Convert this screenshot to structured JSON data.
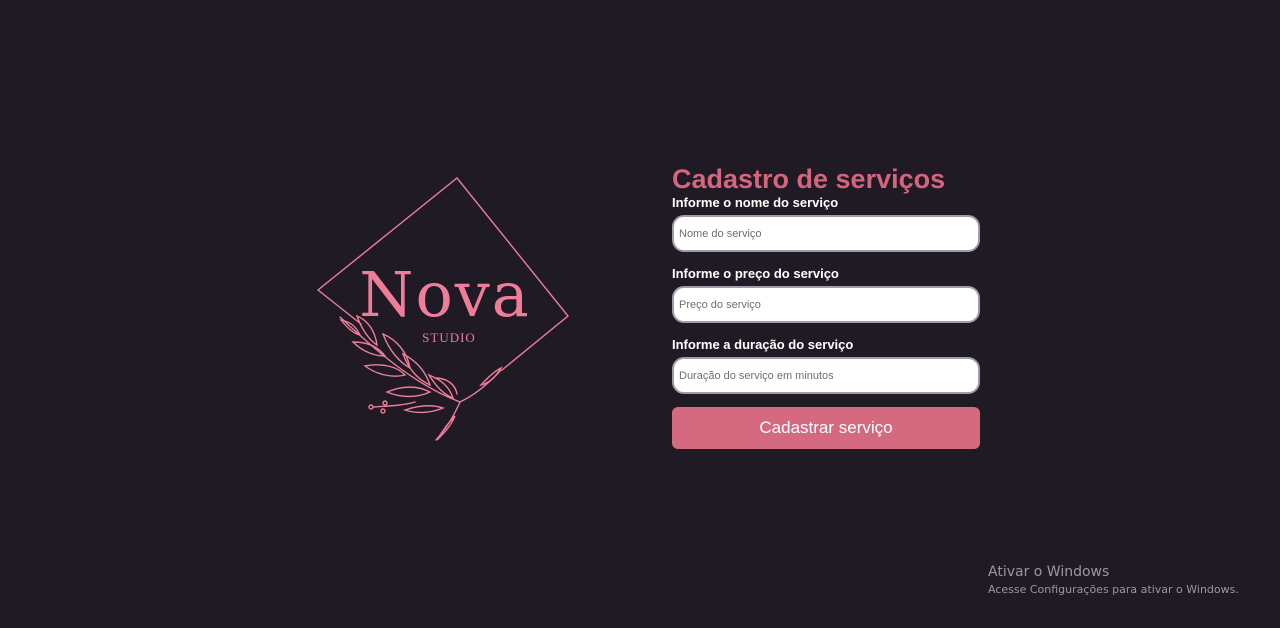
{
  "logo": {
    "word": "Nova",
    "subtitle": "STUDIO"
  },
  "form": {
    "title": "Cadastro de serviços",
    "fields": [
      {
        "label": "Informe o nome do serviço",
        "placeholder": "Nome do serviço",
        "value": ""
      },
      {
        "label": "Informe o preço do serviço",
        "placeholder": "Preço do serviço",
        "value": ""
      },
      {
        "label": "Informe a duração do serviço",
        "placeholder": "Duração do serviço em minutos",
        "value": ""
      }
    ],
    "submit_label": "Cadastrar serviço"
  },
  "watermark": {
    "title": "Ativar o Windows",
    "subtitle": "Acesse Configurações para ativar o Windows."
  },
  "colors": {
    "background": "#1f1a24",
    "accent": "#d4697f",
    "logo": "#ee7d9a"
  }
}
